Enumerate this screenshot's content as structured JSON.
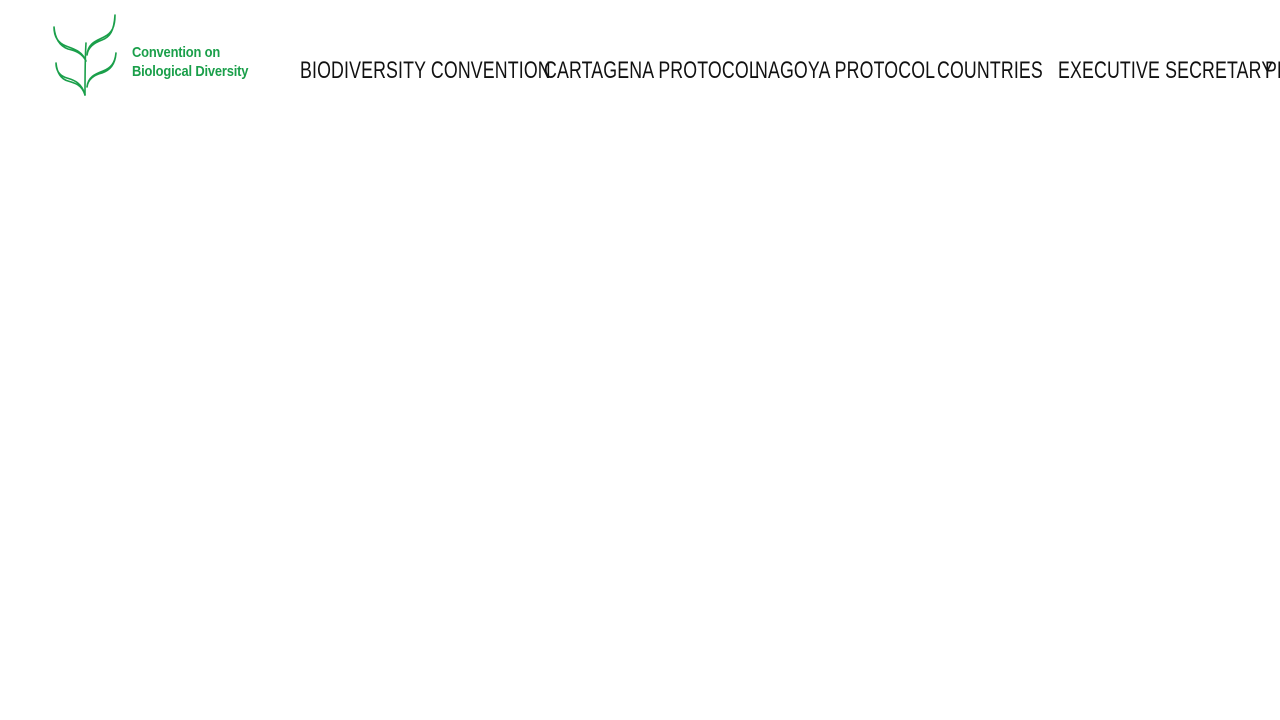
{
  "header": {
    "logo": {
      "line1": "Convention on",
      "line2": "Biological Diversity",
      "icon": "leaf-plant-icon",
      "color": "#1a9f4a"
    },
    "nav": [
      {
        "label": "BIODIVERSITY CONVENTION"
      },
      {
        "label": "CARTAGENA PROTOCOL"
      },
      {
        "label": "NAGOYA PROTOCOL"
      },
      {
        "label": "COUNTRIES"
      },
      {
        "label": "EXECUTIVE SECRETARY"
      },
      {
        "label": "PROGRAMMES"
      }
    ]
  },
  "colors": {
    "brand": "#1a9f4a",
    "nav_text": "#111111",
    "background": "#ffffff"
  }
}
